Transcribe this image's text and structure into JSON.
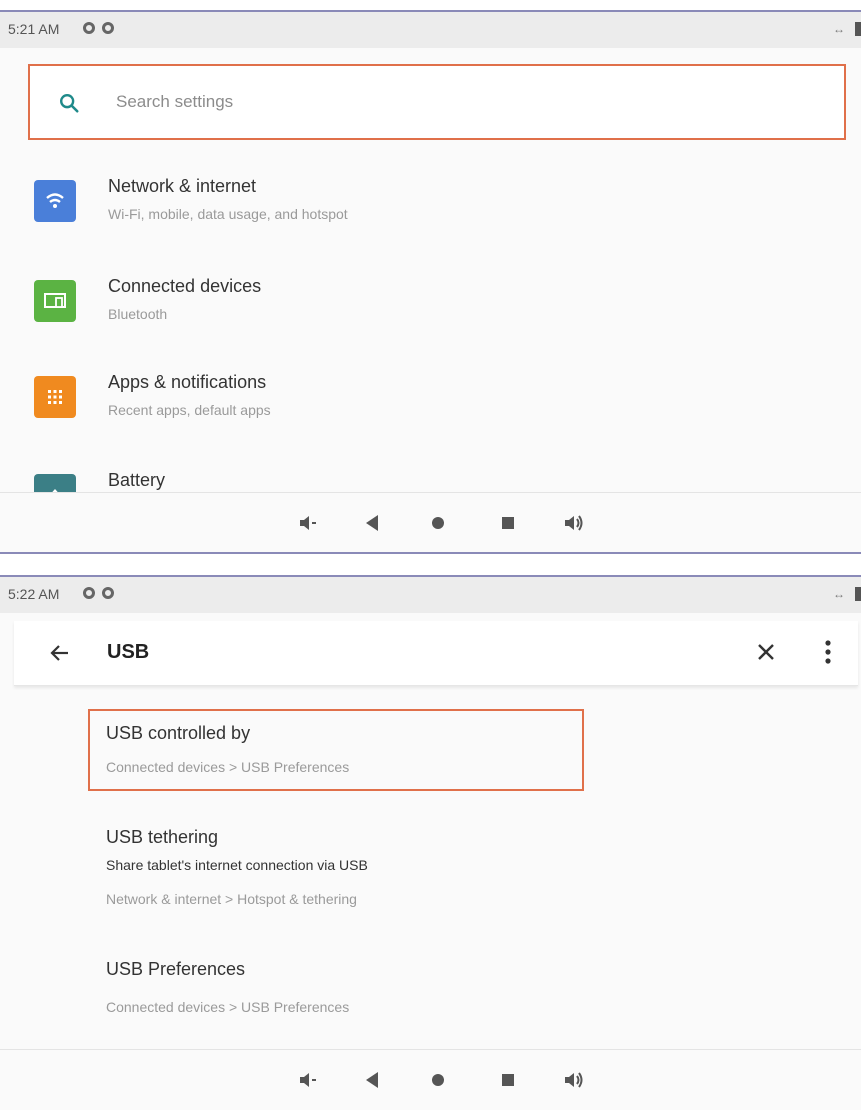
{
  "screen1": {
    "status": {
      "time": "5:21 AM"
    },
    "search": {
      "placeholder": "Search settings"
    },
    "items": [
      {
        "title": "Network & internet",
        "subtitle": "Wi-Fi, mobile, data usage, and hotspot",
        "icon": "wifi-icon",
        "color": "#4a7fd9"
      },
      {
        "title": "Connected devices",
        "subtitle": "Bluetooth",
        "icon": "devices-icon",
        "color": "#5bb343"
      },
      {
        "title": "Apps & notifications",
        "subtitle": "Recent apps, default apps",
        "icon": "apps-icon",
        "color": "#f08a1f"
      },
      {
        "title": "Battery",
        "subtitle": "",
        "icon": "battery-icon",
        "color": "#3b7f86"
      }
    ]
  },
  "screen2": {
    "status": {
      "time": "5:22 AM"
    },
    "search": {
      "query": "USB"
    },
    "results": [
      {
        "title": "USB controlled by",
        "description": "",
        "path": "Connected devices > USB Preferences"
      },
      {
        "title": "USB tethering",
        "description": "Share tablet's internet connection via USB",
        "path": "Network & internet > Hotspot & tethering"
      },
      {
        "title": "USB Preferences",
        "description": "",
        "path": "Connected devices > USB Preferences"
      }
    ]
  },
  "colors": {
    "highlight": "#e0704a",
    "accent": "#1f8a8a"
  }
}
